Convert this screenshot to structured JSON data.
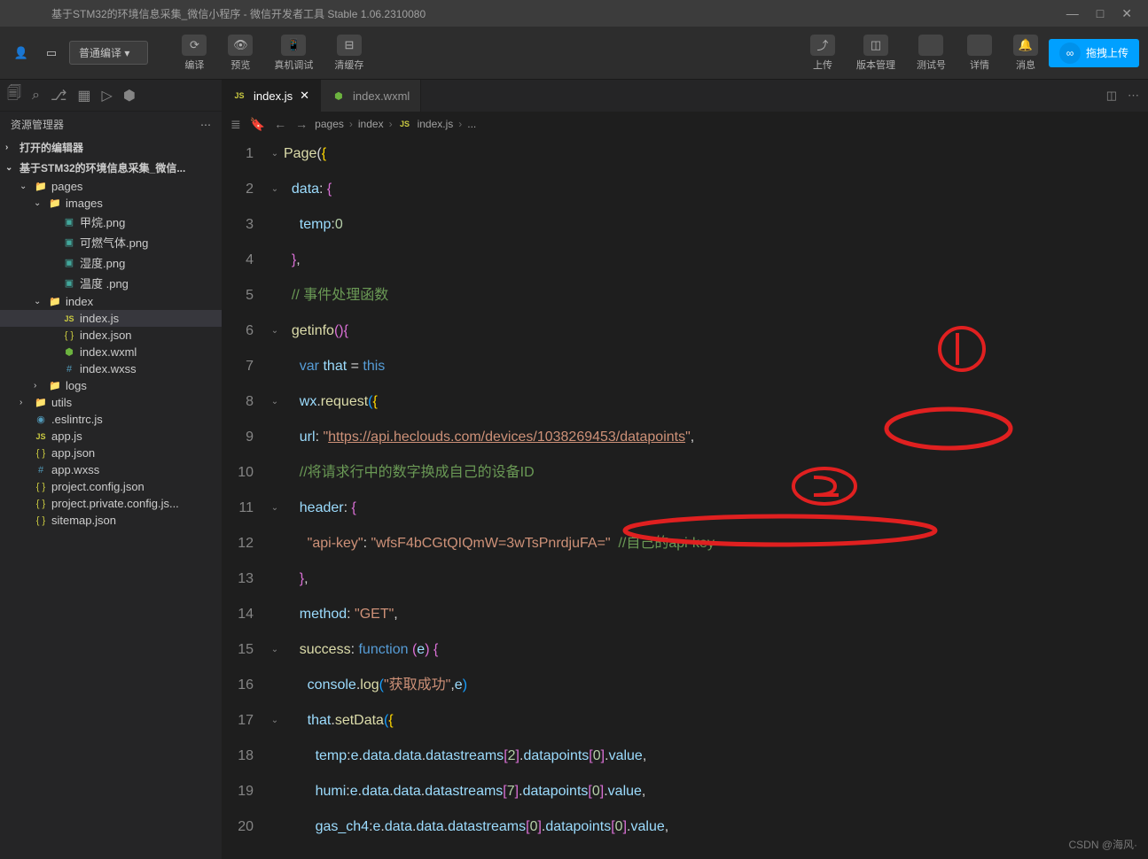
{
  "window": {
    "title": "基于STM32的环境信息采集_微信小程序 - 微信开发者工具 Stable 1.06.2310080"
  },
  "toolbar": {
    "compile_mode": "普通编译",
    "actions": [
      {
        "icon": "⟳",
        "label": "编译"
      },
      {
        "icon": "👁",
        "label": "预览"
      },
      {
        "icon": "📱",
        "label": "真机调试"
      },
      {
        "icon": "⊟",
        "label": "清缓存"
      }
    ],
    "right": [
      {
        "icon": "⤴",
        "label": "上传"
      },
      {
        "icon": "◫",
        "label": "版本管理"
      },
      {
        "icon": "",
        "label": "测试号"
      },
      {
        "icon": "",
        "label": "详情"
      },
      {
        "icon": "🔔",
        "label": "消息"
      }
    ],
    "upload_badge": "拖拽上传"
  },
  "sidebar": {
    "title": "资源管理器",
    "sections": {
      "editors": "打开的编辑器",
      "project": "基于STM32的环境信息采集_微信..."
    },
    "tree": [
      {
        "type": "folder",
        "name": "pages",
        "depth": 1,
        "open": true
      },
      {
        "type": "folder",
        "name": "images",
        "depth": 2,
        "open": true
      },
      {
        "type": "img",
        "name": "甲烷.png",
        "depth": 3
      },
      {
        "type": "img",
        "name": "可燃气体.png",
        "depth": 3
      },
      {
        "type": "img",
        "name": "湿度.png",
        "depth": 3
      },
      {
        "type": "img",
        "name": "温度 .png",
        "depth": 3
      },
      {
        "type": "folder",
        "name": "index",
        "depth": 2,
        "open": true
      },
      {
        "type": "js",
        "name": "index.js",
        "depth": 3,
        "selected": true
      },
      {
        "type": "json",
        "name": "index.json",
        "depth": 3
      },
      {
        "type": "wxml",
        "name": "index.wxml",
        "depth": 3
      },
      {
        "type": "wxss",
        "name": "index.wxss",
        "depth": 3
      },
      {
        "type": "folder",
        "name": "logs",
        "depth": 2,
        "open": false
      },
      {
        "type": "folder",
        "name": "utils",
        "depth": 1,
        "open": false
      },
      {
        "type": "js",
        "name": ".eslintrc.js",
        "depth": 1,
        "icon": "eslint"
      },
      {
        "type": "js",
        "name": "app.js",
        "depth": 1
      },
      {
        "type": "json",
        "name": "app.json",
        "depth": 1
      },
      {
        "type": "wxss",
        "name": "app.wxss",
        "depth": 1
      },
      {
        "type": "json",
        "name": "project.config.json",
        "depth": 1
      },
      {
        "type": "json",
        "name": "project.private.config.js...",
        "depth": 1
      },
      {
        "type": "json",
        "name": "sitemap.json",
        "depth": 1
      }
    ]
  },
  "tabs": [
    {
      "icon": "JS",
      "name": "index.js",
      "active": true,
      "dirty": false
    },
    {
      "icon": "wxml",
      "name": "index.wxml",
      "active": false
    }
  ],
  "breadcrumb": [
    "pages",
    "index",
    "index.js",
    "..."
  ],
  "code": {
    "lines": [
      {
        "n": 1,
        "fold": "v",
        "html": "<span class='c-fn'>Page</span>(<span class='c-brace'>{</span>"
      },
      {
        "n": 2,
        "fold": "v",
        "html": "  <span class='c-prop'>data</span>: <span class='c-brace2'>{</span>"
      },
      {
        "n": 3,
        "html": "    <span class='c-prop'>temp</span>:<span class='c-num'>0</span>"
      },
      {
        "n": 4,
        "html": "  <span class='c-brace2'>}</span>,"
      },
      {
        "n": 5,
        "html": "  <span class='c-cmt'>// 事件处理函数</span>"
      },
      {
        "n": 6,
        "fold": "v",
        "html": "  <span class='c-fn'>getinfo</span><span class='c-brace2'>()</span><span class='c-brace2'>{</span>"
      },
      {
        "n": 7,
        "html": "    <span class='c-kw'>var</span> <span class='c-var'>that</span> = <span class='c-this'>this</span>"
      },
      {
        "n": 8,
        "fold": "v",
        "html": "    <span class='c-var'>wx</span>.<span class='c-fn'>request</span><span class='c-brace3'>(</span><span class='c-brace'>{</span>"
      },
      {
        "n": 9,
        "html": "    <span class='c-prop'>url</span>: <span class='c-str'>\"</span><span class='c-url'>https://api.heclouds.com/devices/1038269453/datapoints</span><span class='c-str'>\"</span>,"
      },
      {
        "n": 10,
        "html": "    <span class='c-cmt'>//将请求行中的数字换成自己的设备ID</span>"
      },
      {
        "n": 11,
        "fold": "v",
        "html": "    <span class='c-prop'>header</span>: <span class='c-brace2'>{</span>"
      },
      {
        "n": 12,
        "html": "      <span class='c-str'>\"api-key\"</span>: <span class='c-str'>\"wfsF4bCGtQIQmW=3wTsPnrdjuFA=\"</span>  <span class='c-cmt'>//自己的api-key</span>"
      },
      {
        "n": 13,
        "html": "    <span class='c-brace2'>}</span>,"
      },
      {
        "n": 14,
        "html": "    <span class='c-prop'>method</span>: <span class='c-str'>\"GET\"</span>,"
      },
      {
        "n": 15,
        "fold": "v",
        "html": "    <span class='c-fn'>success</span>: <span class='c-kw'>function</span> <span class='c-brace2'>(</span><span class='c-var'>e</span><span class='c-brace2'>)</span> <span class='c-brace2'>{</span>"
      },
      {
        "n": 16,
        "html": "      <span class='c-var'>console</span>.<span class='c-fn'>log</span><span class='c-brace3'>(</span><span class='c-str'>\"获取成功\"</span>,<span class='c-var'>e</span><span class='c-brace3'>)</span>"
      },
      {
        "n": 17,
        "fold": "v",
        "html": "      <span class='c-var'>that</span>.<span class='c-fn'>setData</span><span class='c-brace3'>(</span><span class='c-brace'>{</span>"
      },
      {
        "n": 18,
        "html": "        <span class='c-prop'>temp</span>:<span class='c-var'>e</span>.<span class='c-var'>data</span>.<span class='c-var'>data</span>.<span class='c-var'>datastreams</span><span class='c-brace2'>[</span><span class='c-num'>2</span><span class='c-brace2'>]</span>.<span class='c-var'>datapoints</span><span class='c-brace2'>[</span><span class='c-num'>0</span><span class='c-brace2'>]</span>.<span class='c-var'>value</span>,"
      },
      {
        "n": 19,
        "html": "        <span class='c-prop'>humi</span>:<span class='c-var'>e</span>.<span class='c-var'>data</span>.<span class='c-var'>data</span>.<span class='c-var'>datastreams</span><span class='c-brace2'>[</span><span class='c-num'>7</span><span class='c-brace2'>]</span>.<span class='c-var'>datapoints</span><span class='c-brace2'>[</span><span class='c-num'>0</span><span class='c-brace2'>]</span>.<span class='c-var'>value</span>,"
      },
      {
        "n": 20,
        "html": "        <span class='c-prop'>gas_ch4</span>:<span class='c-var'>e</span>.<span class='c-var'>data</span>.<span class='c-var'>data</span>.<span class='c-var'>datastreams</span><span class='c-brace2'>[</span><span class='c-num'>0</span><span class='c-brace2'>]</span>.<span class='c-var'>datapoints</span><span class='c-brace2'>[</span><span class='c-num'>0</span><span class='c-brace2'>]</span>.<span class='c-var'>value</span>,"
      }
    ]
  },
  "watermark": "CSDN @海风·"
}
